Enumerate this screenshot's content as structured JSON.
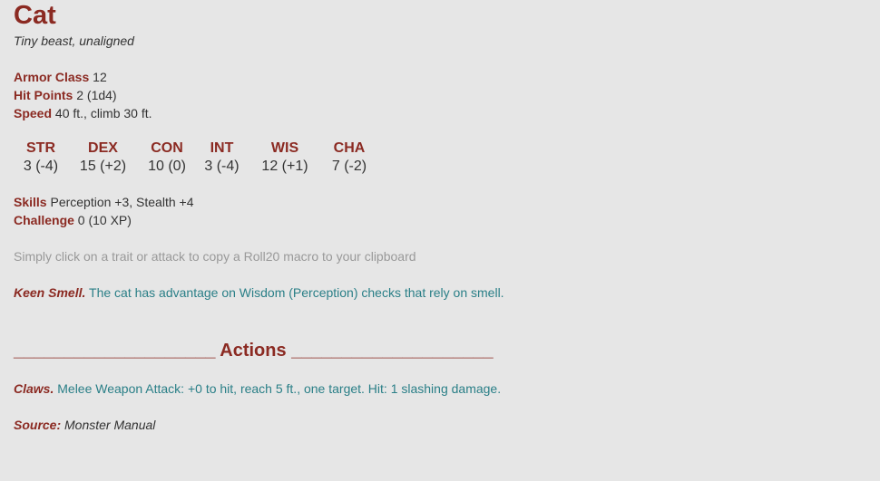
{
  "monster": {
    "name": "Cat",
    "type_line": "Tiny beast, unaligned"
  },
  "stats": {
    "armor_class_label": "Armor Class",
    "armor_class_value": "12",
    "hit_points_label": "Hit Points",
    "hit_points_value": "2 (1d4)",
    "speed_label": "Speed",
    "speed_value": "40 ft., climb 30 ft."
  },
  "abilities": [
    {
      "name": "STR",
      "score": "3 (-4)"
    },
    {
      "name": "DEX",
      "score": "15 (+2)"
    },
    {
      "name": "CON",
      "score": "10 (0)"
    },
    {
      "name": "INT",
      "score": "3 (-4)"
    },
    {
      "name": "WIS",
      "score": "12 (+1)"
    },
    {
      "name": "CHA",
      "score": "7 (-2)"
    }
  ],
  "details": {
    "skills_label": "Skills",
    "skills_value": "Perception +3, Stealth +4",
    "challenge_label": "Challenge",
    "challenge_value": "0 (10 XP)"
  },
  "hint": "Simply click on a trait or attack to copy a Roll20 macro to your clipboard",
  "traits": [
    {
      "name": "Keen Smell.",
      "text": "The cat has advantage on Wisdom (Perception) checks that rely on smell."
    }
  ],
  "actions_header": "____________________ Actions ____________________",
  "actions": [
    {
      "name": "Claws.",
      "text": "Melee Weapon Attack: +0 to hit, reach 5 ft., one target. Hit: 1 slashing damage."
    }
  ],
  "source": {
    "label": "Source:",
    "value": "Monster Manual"
  },
  "colors": {
    "accent": "#8b2a22",
    "link_text": "#2a7f87",
    "hint_text": "#999999",
    "background": "#e6e6e6"
  }
}
